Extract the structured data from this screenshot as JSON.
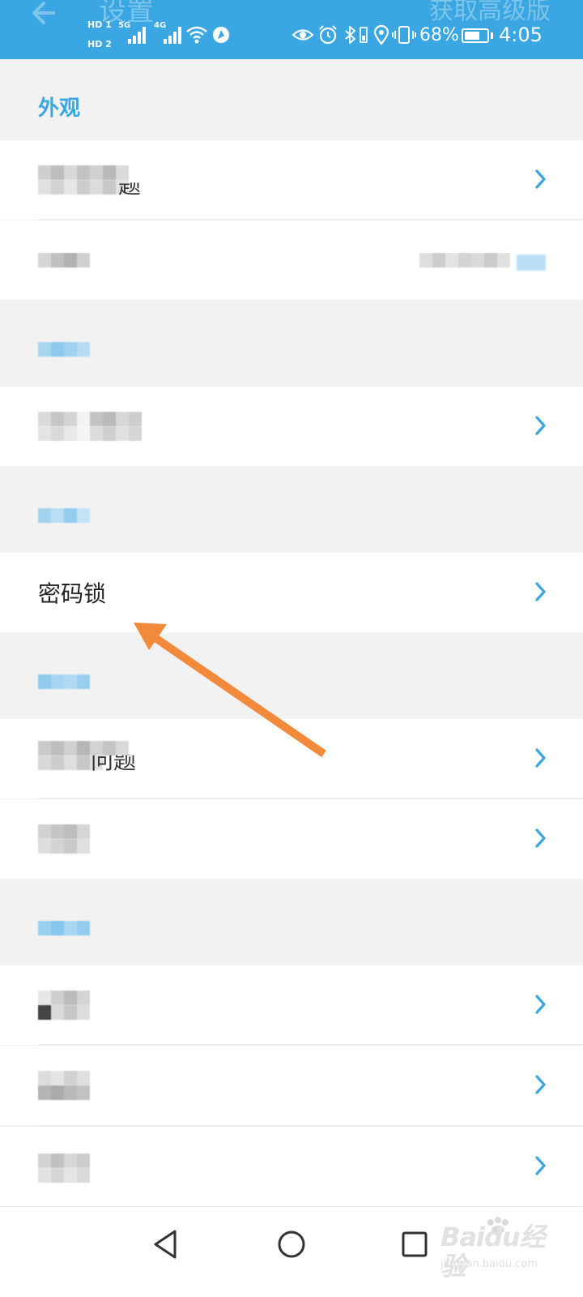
{
  "app_bar": {
    "back_icon": "back-arrow-icon",
    "title": "设置",
    "pro_label": "获取高级版"
  },
  "status_bar": {
    "hd1": "HD 1",
    "hd2": "HD 2",
    "net1": "5G",
    "net2": "4G",
    "battery_percent": "68%",
    "battery_level": 0.68,
    "time": "4:05",
    "icons": [
      "eye-icon",
      "alarm-icon",
      "bluetooth-icon",
      "location-icon",
      "vibrate-icon"
    ]
  },
  "colors": {
    "accent": "#3aa6e2",
    "annotation_arrow": "#f28a3c",
    "background": "#f2f2f2"
  },
  "sections": {
    "appearance": {
      "header": "外观",
      "row1_suffix": "题",
      "row1_chevron": "chevron-right-icon"
    },
    "lock": {
      "password_lock_label": "密码锁"
    },
    "feedback": {
      "row1_suffix": "问题"
    }
  },
  "nav_bar": {
    "back": "nav-back-icon",
    "home": "nav-home-icon",
    "recents": "nav-recents-icon"
  },
  "watermark": {
    "brand": "Baidu经验",
    "url": "jingyan.baidu.com"
  }
}
